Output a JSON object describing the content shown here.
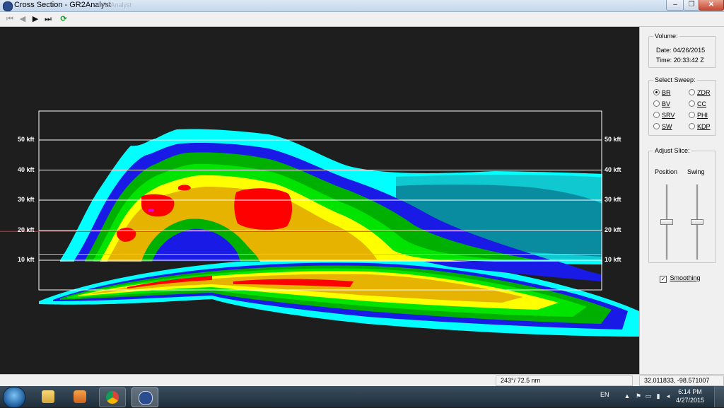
{
  "window": {
    "title": "Cross Section - GR2Analyst",
    "title_ghost": "GR2Analyst",
    "min_symbol": "–",
    "max_symbol": "❐",
    "close_symbol": "✕"
  },
  "toolbar": {
    "icons": [
      "first-frame-icon",
      "prev-frame-icon",
      "play-icon",
      "last-frame-icon",
      "refresh-icon"
    ],
    "first_symbol": "⏮",
    "prev_symbol": "◀",
    "play_symbol": "▶",
    "last_symbol": "⏭",
    "refresh_symbol": "⟳"
  },
  "plot": {
    "altitude_labels": [
      "50 kft",
      "40 kft",
      "30 kft",
      "20 kft",
      "10 kft"
    ],
    "altitude_values": [
      50,
      40,
      30,
      20,
      10
    ],
    "grid_color": "#ffffff",
    "red_line_color": "#ff1e1e",
    "yellow_line_color": "#d8d020",
    "color_scale": [
      "#00ffff",
      "#10c8d0",
      "#0a8ca0",
      "#1a1ae6",
      "#00b000",
      "#00e400",
      "#ffff00",
      "#e6b400",
      "#ff0000",
      "#e000e0"
    ]
  },
  "volume": {
    "legend": "Volume:",
    "date_label": "Date:",
    "date": "04/26/2015",
    "time_label": "Time:",
    "time": "20:33:42 Z"
  },
  "sweep": {
    "legend": "Select Sweep:",
    "options": [
      {
        "label": "BR",
        "selected": true
      },
      {
        "label": "ZDR",
        "selected": false
      },
      {
        "label": "BV",
        "selected": false
      },
      {
        "label": "CC",
        "selected": false
      },
      {
        "label": "SRV",
        "selected": false
      },
      {
        "label": "PHI",
        "selected": false
      },
      {
        "label": "SW",
        "selected": false
      },
      {
        "label": "KDP",
        "selected": false
      }
    ]
  },
  "slice": {
    "legend": "Adjust Slice:",
    "position_label": "Position",
    "swing_label": "Swing",
    "position_level": 0.5,
    "swing_level": 0.5
  },
  "smoothing": {
    "label": "Smoothing",
    "checked": true,
    "check_symbol": "✓"
  },
  "status": {
    "azimuth_range": "243°/ 72.5 nm",
    "lat_lon": "32.011833, -98.571007"
  },
  "taskbar": {
    "language": "EN",
    "time": "6:14 PM",
    "date": "4/27/2015"
  }
}
